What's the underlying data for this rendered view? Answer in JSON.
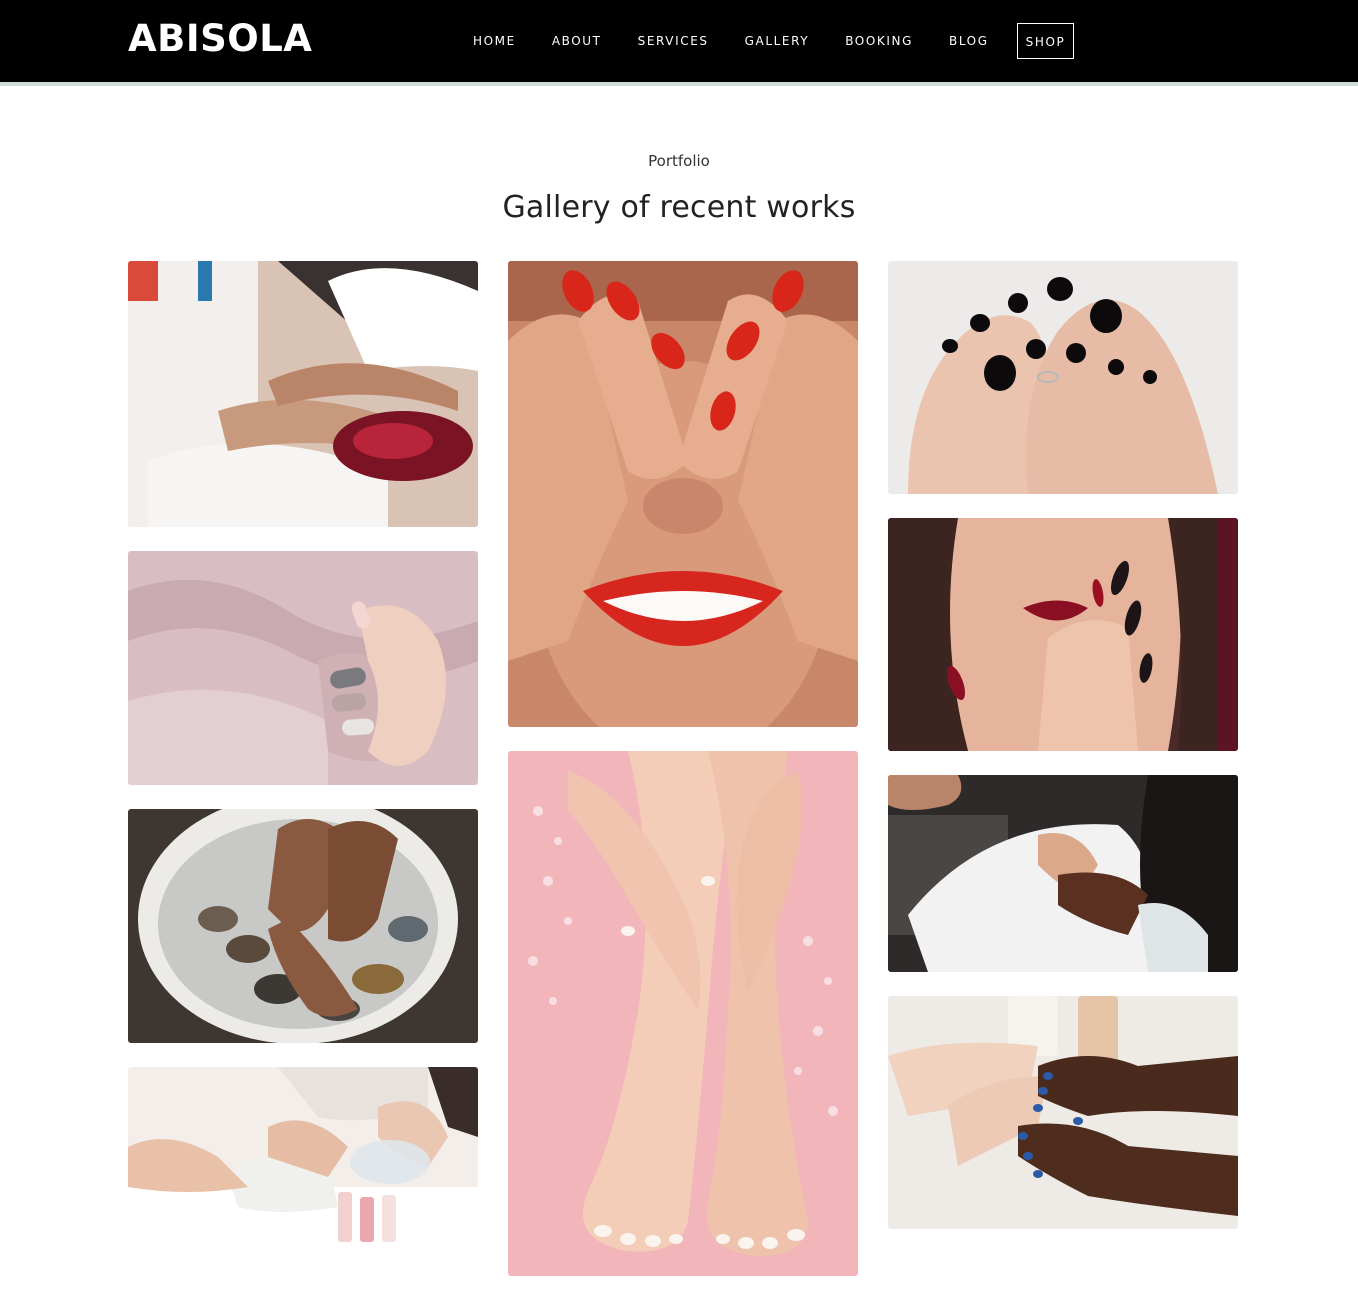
{
  "header": {
    "brand": "ABISOLA",
    "nav": [
      {
        "id": "home",
        "label": "HOME"
      },
      {
        "id": "about",
        "label": "ABOUT"
      },
      {
        "id": "services",
        "label": "SERVICES"
      },
      {
        "id": "gallery",
        "label": "GALLERY"
      },
      {
        "id": "booking",
        "label": "BOOKING"
      },
      {
        "id": "blog",
        "label": "BLOG"
      },
      {
        "id": "shop",
        "label": "SHOP"
      }
    ]
  },
  "gallery": {
    "kicker": "Portfolio",
    "title": "Gallery of recent works",
    "photos": [
      {
        "id": "pedicure-salon-treatment",
        "bg": "#e7d2c4",
        "accent": "#c39a7e"
      },
      {
        "id": "pink-knit-sweater-manicure",
        "bg": "#dcc3c7",
        "accent": "#b79a9f"
      },
      {
        "id": "foot-soak-stone-bowl",
        "bg": "#4a423c",
        "accent": "#e8e6e2"
      },
      {
        "id": "manicure-table-polish-bottles",
        "bg": "#efe7e2",
        "accent": "#c9a08a"
      },
      {
        "id": "red-nails-covering-eyes",
        "bg": "#d89a78",
        "accent": "#d82c1e"
      },
      {
        "id": "pink-french-pedicure-feet",
        "bg": "#f0b9bc",
        "accent": "#f5d0c4"
      },
      {
        "id": "black-toenail-polish",
        "bg": "#ebe8e6",
        "accent": "#e9c2ad"
      },
      {
        "id": "burgundy-nail-art-portrait",
        "bg": "#5a2a2e",
        "accent": "#8a1020"
      },
      {
        "id": "nail-technician-at-work",
        "bg": "#3a3533",
        "accent": "#f2f2f2"
      },
      {
        "id": "blue-polish-manicure",
        "bg": "#eeeae6",
        "accent": "#2a5aa8"
      }
    ]
  }
}
